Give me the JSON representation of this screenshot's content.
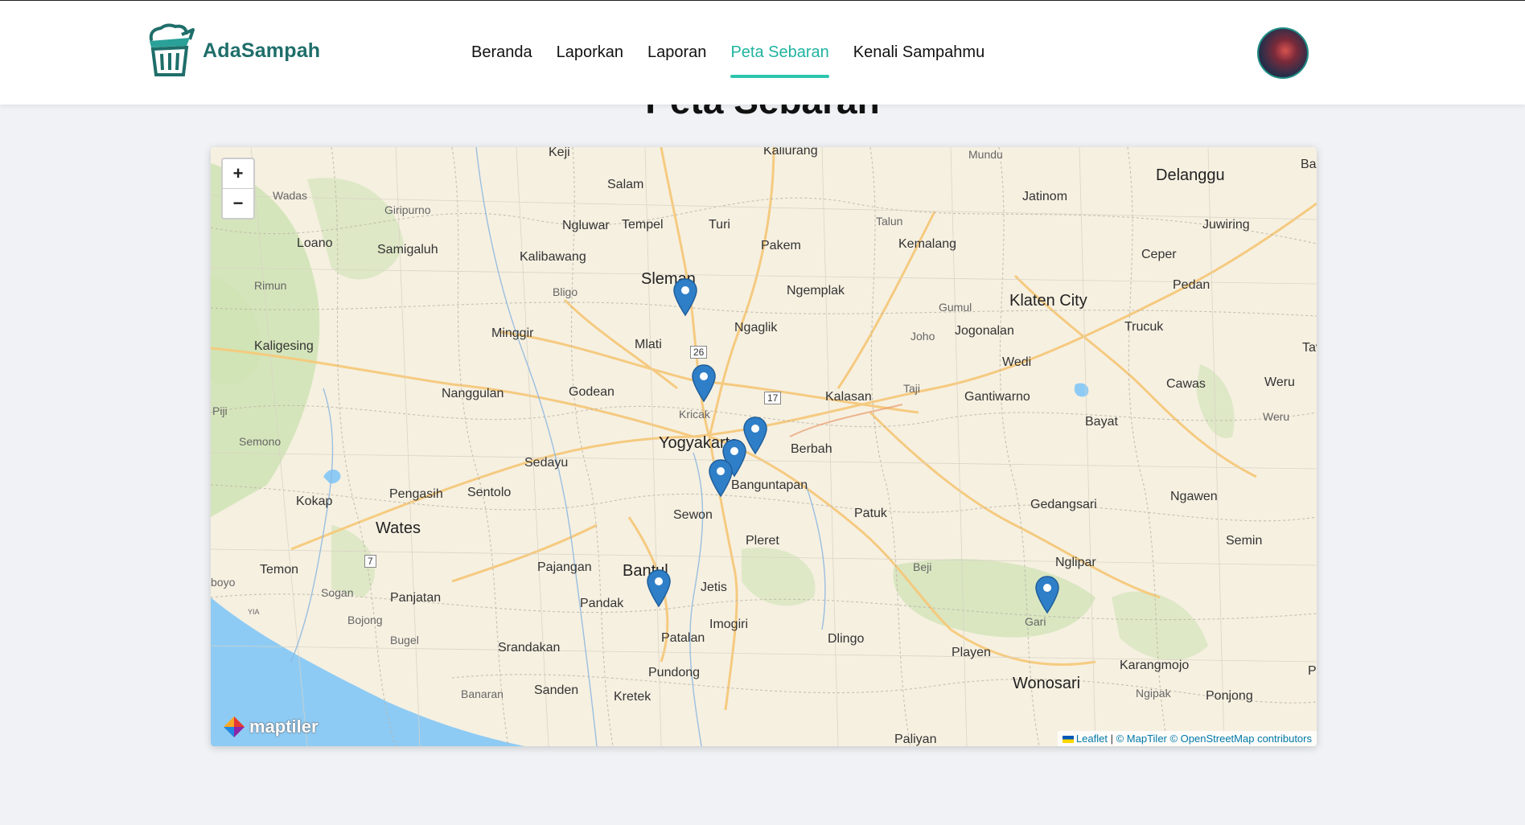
{
  "brand": {
    "name": "AdaSampah"
  },
  "nav": {
    "items": [
      {
        "label": "Beranda"
      },
      {
        "label": "Laporkan"
      },
      {
        "label": "Laporan"
      },
      {
        "label": "Peta Sebaran"
      },
      {
        "label": "Kenali Sampahmu"
      }
    ],
    "active": "Peta Sebaran"
  },
  "page": {
    "title": "Peta Sebaran"
  },
  "map": {
    "zoom_in": "+",
    "zoom_out": "−",
    "provider_logo": "maptiler",
    "attribution": {
      "leaflet": "Leaflet",
      "sep": "|",
      "rest": "© MapTiler © OpenStreetMap contributors"
    },
    "colors": {
      "marker": "#2f7fc8",
      "water": "#8ecbf4",
      "land": "#f6f0e1",
      "road": "#f5c97b",
      "forest": "#cfe3b4"
    },
    "place_labels": {
      "keji": "Keji",
      "kaliurang": "Kaliurang",
      "mundu": "Mundu",
      "salam": "Salam",
      "delanggu": "Delanggu",
      "ba": "Ba",
      "wadas": "Wadas",
      "giripurno": "Giripurno",
      "jatinom": "Jatinom",
      "ngluwar": "Ngluwar",
      "tempel": "Tempel",
      "turi": "Turi",
      "talun": "Talun",
      "juwiring": "Juwiring",
      "loano": "Loano",
      "samigaluh": "Samigaluh",
      "kalibawang": "Kalibawang",
      "pakem": "Pakem",
      "kemalang": "Kemalang",
      "ceper": "Ceper",
      "rimun": "Rimun",
      "bligo": "Bligo",
      "sleman": "Sleman",
      "ngemplak": "Ngemplak",
      "pedan": "Pedan",
      "gumul": "Gumul",
      "klaten": "Klaten City",
      "minggir": "Minggir",
      "ngaglik": "Ngaglik",
      "joho": "Joho",
      "jogonalan": "Jogonalan",
      "trucuk": "Trucuk",
      "kaligesing": "Kaligesing",
      "mlati": "Mlati",
      "wedi": "Wedi",
      "tav": "Tav",
      "nanggulan": "Nanggulan",
      "godean": "Godean",
      "kalasan": "Kalasan",
      "taji": "Taji",
      "gantiwarno": "Gantiwarno",
      "cawas": "Cawas",
      "weru": "Weru",
      "weru2": "Weru",
      "piji": "Piji",
      "kricak": "Kricak",
      "bayat": "Bayat",
      "semono": "Semono",
      "yogyakarta": "Yogyakarta",
      "berbah": "Berbah",
      "sedayu": "Sedayu",
      "banguntapan": "Banguntapan",
      "pengasih": "Pengasih",
      "sentolo": "Sentolo",
      "kokap": "Kokap",
      "gedangsari": "Gedangsari",
      "ngawen": "Ngawen",
      "wates": "Wates",
      "sewon": "Sewon",
      "patuk": "Patuk",
      "pleret": "Pleret",
      "semin": "Semin",
      "temon": "Temon",
      "pajangan": "Pajangan",
      "bantul": "Bantul",
      "beji": "Beji",
      "nglipar": "Nglipar",
      "boyo": "boyo",
      "sogan": "Sogan",
      "panjatan": "Panjatan",
      "jetis": "Jetis",
      "pandak": "Pandak",
      "gari": "Gari",
      "bojong": "Bojong",
      "imogiri": "Imogiri",
      "bugel": "Bugel",
      "patalan": "Patalan",
      "dlingo": "Dlingo",
      "srandakan": "Srandakan",
      "playen": "Playen",
      "karangmojo": "Karangmojo",
      "pundong": "Pundong",
      "banaran": "Banaran",
      "sanden": "Sanden",
      "wonosari": "Wonosari",
      "ngipak": "Ngipak",
      "ponjong": "Ponjong",
      "kretek": "Kretek",
      "paliyan": "Paliyan",
      "p": "P",
      "yia": "YIA",
      "route26": "26",
      "route17": "17",
      "route7": "7"
    }
  }
}
